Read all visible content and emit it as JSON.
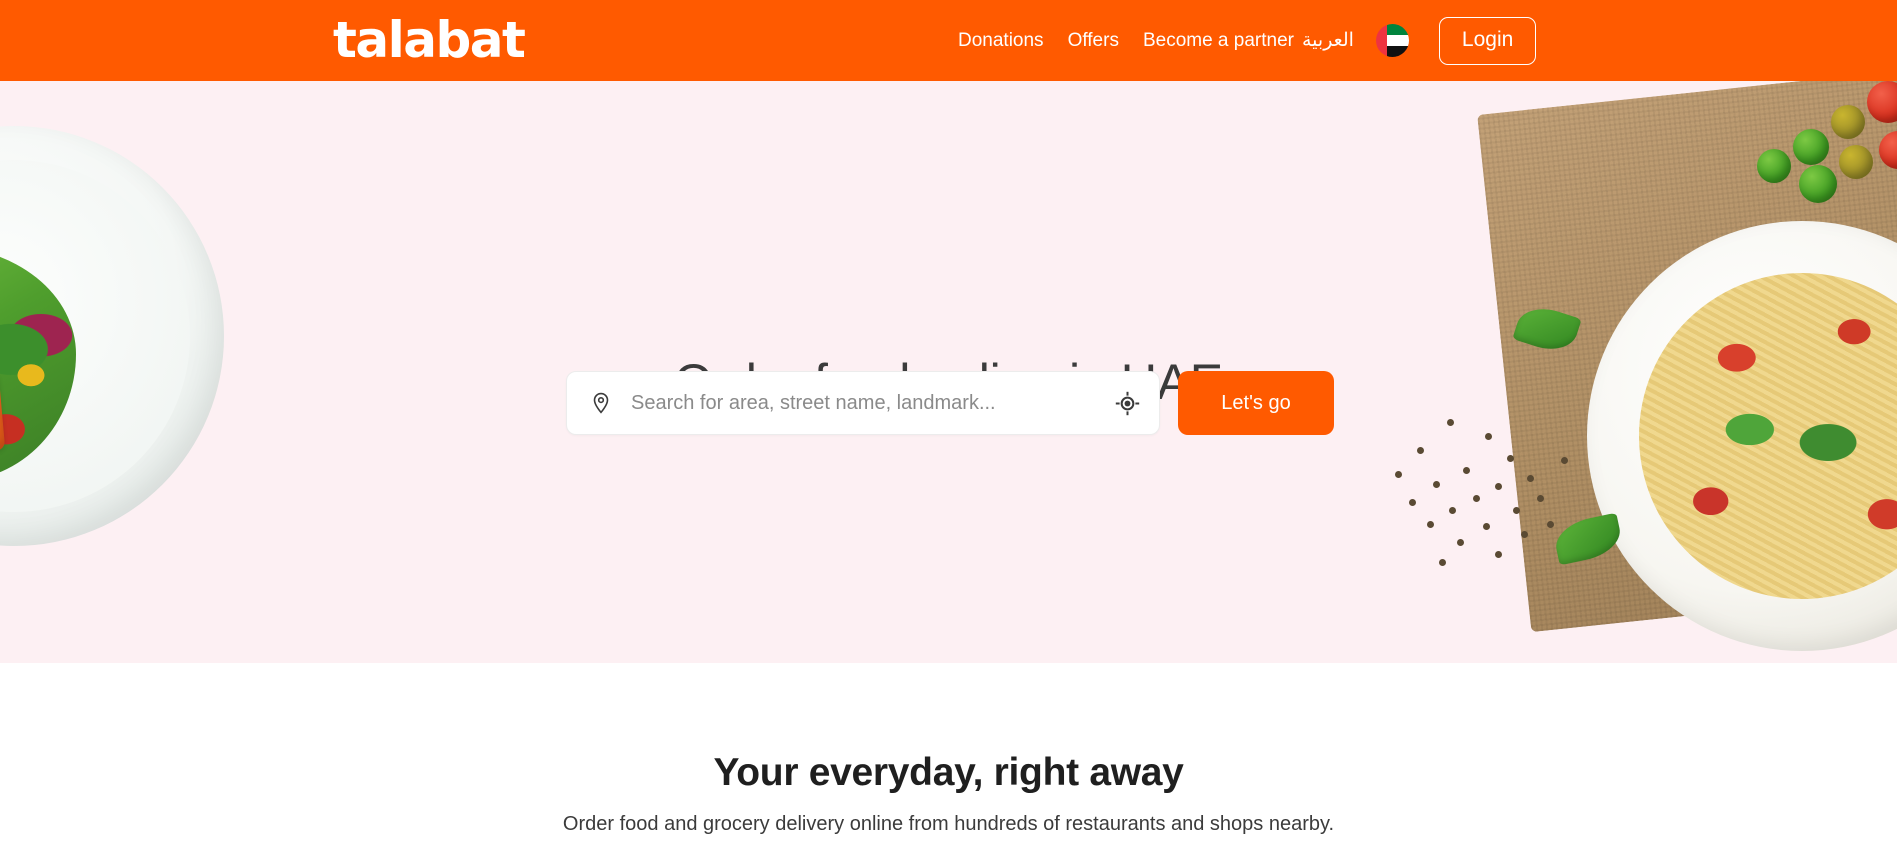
{
  "header": {
    "logo_text": "talabat",
    "nav_links": [
      {
        "label": "Donations"
      },
      {
        "label": "Offers"
      },
      {
        "label": "Become a partner"
      }
    ],
    "language_label": "العربية",
    "country_flag": "uae-flag-icon",
    "login_label": "Login",
    "background_color": "#ff5a00"
  },
  "hero": {
    "title": "Order food online in UAE",
    "background_color": "#fdf0f3",
    "search": {
      "placeholder": "Search for area, street name, landmark...",
      "value": "",
      "pin_icon": "location-pin-icon",
      "gps_icon": "current-location-icon"
    },
    "cta_label": "Let's go",
    "cta_color": "#ff5a00",
    "left_image": "salmon-salad-plate",
    "right_image": "spaghetti-plate-with-tomatoes"
  },
  "lower_section": {
    "title": "Your everyday, right away",
    "subtitle": "Order food and grocery delivery online from hundreds of restaurants and shops nearby.",
    "background_color": "#ffffff"
  }
}
